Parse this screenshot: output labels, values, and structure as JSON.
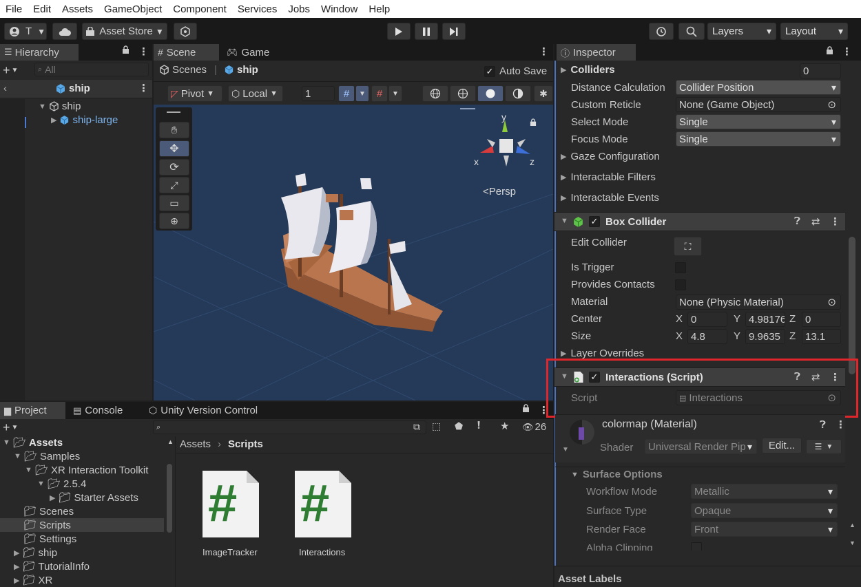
{
  "menu": [
    "File",
    "Edit",
    "Assets",
    "GameObject",
    "Component",
    "Services",
    "Jobs",
    "Window",
    "Help"
  ],
  "toolbar": {
    "account": "T",
    "asset_store": "Asset Store",
    "layers": "Layers",
    "layout": "Layout"
  },
  "hierarchy": {
    "tab": "Hierarchy",
    "search_placeholder": "All",
    "header": "ship",
    "items": [
      "ship",
      "ship-large"
    ]
  },
  "scene": {
    "tabs": [
      "Scene",
      "Game"
    ],
    "breadcrumb_root": "Scenes",
    "breadcrumb_current": "ship",
    "auto_save": "Auto Save",
    "pivot": "Pivot",
    "local": "Local",
    "grid_value": "1",
    "persp": "<Persp",
    "gizmo": {
      "y": "y",
      "x": "x",
      "z": "z"
    }
  },
  "project": {
    "tabs": [
      "Project",
      "Console",
      "Unity Version Control"
    ],
    "hidden_count": "26",
    "tree": [
      "Assets",
      "Samples",
      "XR Interaction Toolkit",
      "2.5.4",
      "Starter Assets",
      "Scenes",
      "Scripts",
      "Settings",
      "ship",
      "TutorialInfo",
      "XR"
    ],
    "path_root": "Assets",
    "path_current": "Scripts",
    "files": [
      {
        "name": "ImageTracker",
        "glyph": "#"
      },
      {
        "name": "Interactions",
        "glyph": "#"
      }
    ]
  },
  "inspector": {
    "tab": "Inspector",
    "colliders_label": "Colliders",
    "colliders_count": "0",
    "rows": [
      {
        "label": "Distance Calculation",
        "value": "Collider Position",
        "type": "drop"
      },
      {
        "label": "Custom Reticle",
        "value": "None (Game Object)",
        "type": "object"
      },
      {
        "label": "Select Mode",
        "value": "Single",
        "type": "drop"
      },
      {
        "label": "Focus Mode",
        "value": "Single",
        "type": "drop"
      }
    ],
    "foldouts": [
      "Gaze Configuration",
      "Interactable Filters",
      "Interactable Events"
    ],
    "box_collider": {
      "title": "Box Collider",
      "edit_collider": "Edit Collider",
      "is_trigger": "Is Trigger",
      "provides_contacts": "Provides Contacts",
      "material_label": "Material",
      "material_value": "None (Physic Material)",
      "center_label": "Center",
      "center": {
        "x": "0",
        "y": "4.98176",
        "z": "0"
      },
      "size_label": "Size",
      "size": {
        "x": "4.8",
        "y": "9.9635",
        "z": "13.1"
      },
      "layer_overrides": "Layer Overrides"
    },
    "interactions": {
      "title": "Interactions (Script)",
      "script_label": "Script",
      "script_value": "Interactions"
    },
    "material": {
      "name": "colormap (Material)",
      "shader_label": "Shader",
      "shader_value": "Universal Render Pip",
      "edit": "Edit...",
      "surface_options": "Surface Options",
      "rows": [
        {
          "label": "Workflow Mode",
          "value": "Metallic"
        },
        {
          "label": "Surface Type",
          "value": "Opaque"
        },
        {
          "label": "Render Face",
          "value": "Front"
        }
      ],
      "alpha_clipping": "Alpha Clipping"
    },
    "asset_labels": "Asset Labels"
  },
  "colors": {
    "accent": "#4c7bd1",
    "highlight_red": "#e0262b",
    "scene_bg": "#253a58"
  }
}
